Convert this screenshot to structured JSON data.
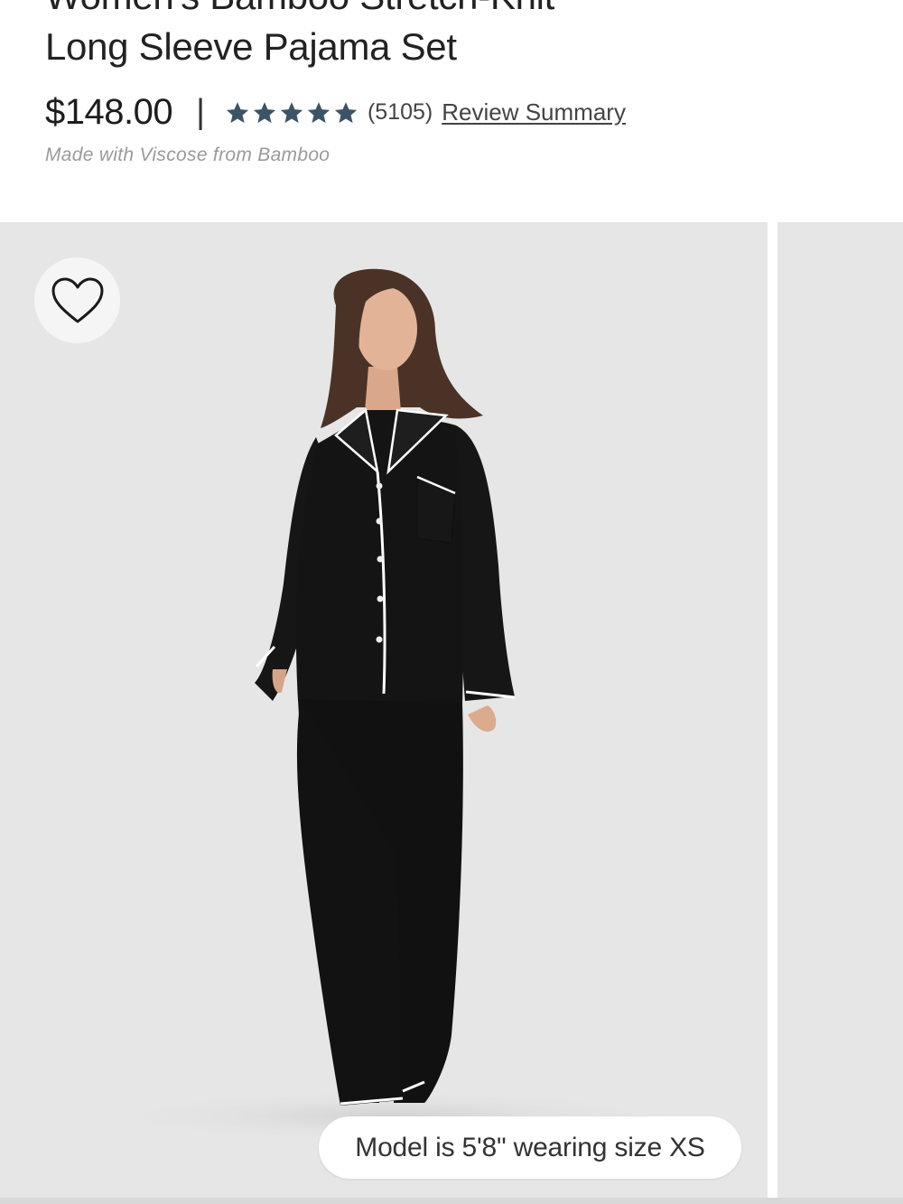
{
  "product": {
    "title_line1": "Women's Bamboo Stretch-Knit",
    "title_line2": "Long Sleeve Pajama Set",
    "price": "$148.00",
    "divider": "|",
    "rating": {
      "stars": 5,
      "max_stars": 5,
      "review_count": "(5105)",
      "summary_link": "Review Summary"
    },
    "tagline": "Made with Viscose from Bamboo"
  },
  "gallery": {
    "favorite_icon": "heart-outline-icon",
    "photo_caption": "Model is 5'8\" wearing size XS"
  },
  "colors": {
    "star": "#3c5566",
    "image_background": "#e6e6e6",
    "garment": "#141414",
    "piping": "#ffffff"
  }
}
